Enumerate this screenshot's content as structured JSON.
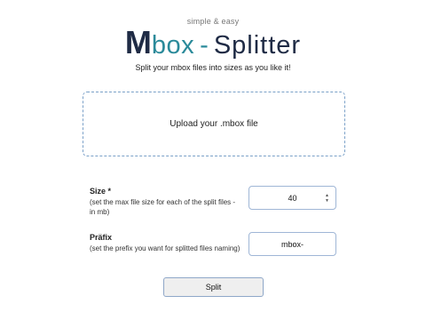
{
  "header": {
    "tagline": "simple & easy",
    "logo_m": "M",
    "logo_box": "box",
    "logo_sep": "-",
    "logo_splitter": "Splitter",
    "subtitle": "Split your mbox files into sizes as you like it!"
  },
  "upload": {
    "label": "Upload your .mbox file"
  },
  "size_field": {
    "title": "Size *",
    "description": "(set the max file size for each of the split files - in mb)",
    "value": "40"
  },
  "prefix_field": {
    "title": "Präfix",
    "description": "(set the prefix you want for splitted files naming)",
    "value": "mbox-"
  },
  "actions": {
    "split_label": "Split"
  },
  "colors": {
    "brand_dark": "#1f2b45",
    "brand_teal": "#2a8a9a",
    "border_blue": "#9fb6d6"
  }
}
